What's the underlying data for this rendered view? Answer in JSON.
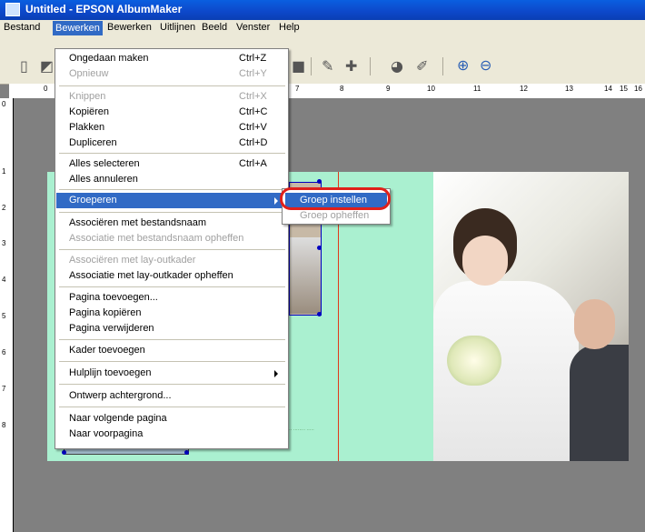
{
  "window": {
    "title": "Untitled - EPSON AlbumMaker"
  },
  "menubar": {
    "items": [
      "Bestand",
      "Bewerken",
      "Bewerken",
      "Uitlijnen",
      "Beeld",
      "Venster",
      "Help"
    ]
  },
  "toolbar": {
    "icons": [
      "new-document-icon",
      "open-icon",
      "stamp-icon",
      "stamp-alt-icon",
      "image-edit-icon",
      "image-effect-icon",
      "zoom-in-icon",
      "zoom-out-icon"
    ]
  },
  "ruler": {
    "horizontal_labels": [
      "0",
      "7",
      "8",
      "9",
      "10",
      "11",
      "12",
      "13",
      "14",
      "15",
      "16"
    ],
    "vertical_labels": [
      "0",
      "1",
      "2",
      "3",
      "4",
      "5",
      "6",
      "7",
      "8"
    ]
  },
  "dropdown": {
    "items": [
      {
        "label": "Ongedaan maken",
        "shortcut": "Ctrl+Z",
        "disabled": false
      },
      {
        "label": "Opnieuw",
        "shortcut": "Ctrl+Y",
        "disabled": true
      },
      {
        "label": "Knippen",
        "shortcut": "Ctrl+X",
        "disabled": true
      },
      {
        "label": "Kopiëren",
        "shortcut": "Ctrl+C",
        "disabled": false
      },
      {
        "label": "Plakken",
        "shortcut": "Ctrl+V",
        "disabled": false
      },
      {
        "label": "Dupliceren",
        "shortcut": "Ctrl+D",
        "disabled": false
      },
      {
        "label": "Alles selecteren",
        "shortcut": "Ctrl+A",
        "disabled": false
      },
      {
        "label": "Alles annuleren",
        "shortcut": "",
        "disabled": false
      },
      {
        "label": "Groeperen",
        "shortcut": "",
        "disabled": false,
        "highlight": true,
        "submenu": true
      },
      {
        "label": "Associëren met bestandsnaam",
        "shortcut": "",
        "disabled": false
      },
      {
        "label": "Associatie met bestandsnaam opheffen",
        "shortcut": "",
        "disabled": true
      },
      {
        "label": "Associëren met lay-outkader",
        "shortcut": "",
        "disabled": true
      },
      {
        "label": "Associatie met lay-outkader opheffen",
        "shortcut": "",
        "disabled": false
      },
      {
        "label": "Pagina toevoegen...",
        "shortcut": "",
        "disabled": false
      },
      {
        "label": "Pagina kopiëren",
        "shortcut": "",
        "disabled": false
      },
      {
        "label": "Pagina verwijderen",
        "shortcut": "",
        "disabled": false
      },
      {
        "label": "Kader toevoegen",
        "shortcut": "",
        "disabled": false
      },
      {
        "label": "Hulplijn toevoegen",
        "shortcut": "",
        "disabled": false,
        "submenu": true
      },
      {
        "label": "Ontwerp achtergrond...",
        "shortcut": "",
        "disabled": false
      },
      {
        "label": "Naar volgende pagina",
        "shortcut": "",
        "disabled": false
      },
      {
        "label": "Naar voorpagina",
        "shortcut": "",
        "disabled": false
      }
    ]
  },
  "submenu": {
    "items": [
      {
        "label": "Groep instellen",
        "disabled": false,
        "highlight": true
      },
      {
        "label": "Groep opheffen",
        "disabled": true
      }
    ]
  },
  "colors": {
    "accent": "#316ac5",
    "page_bg": "#aaf0d0",
    "callout": "#e0201a",
    "guide": "#e03a1a"
  }
}
